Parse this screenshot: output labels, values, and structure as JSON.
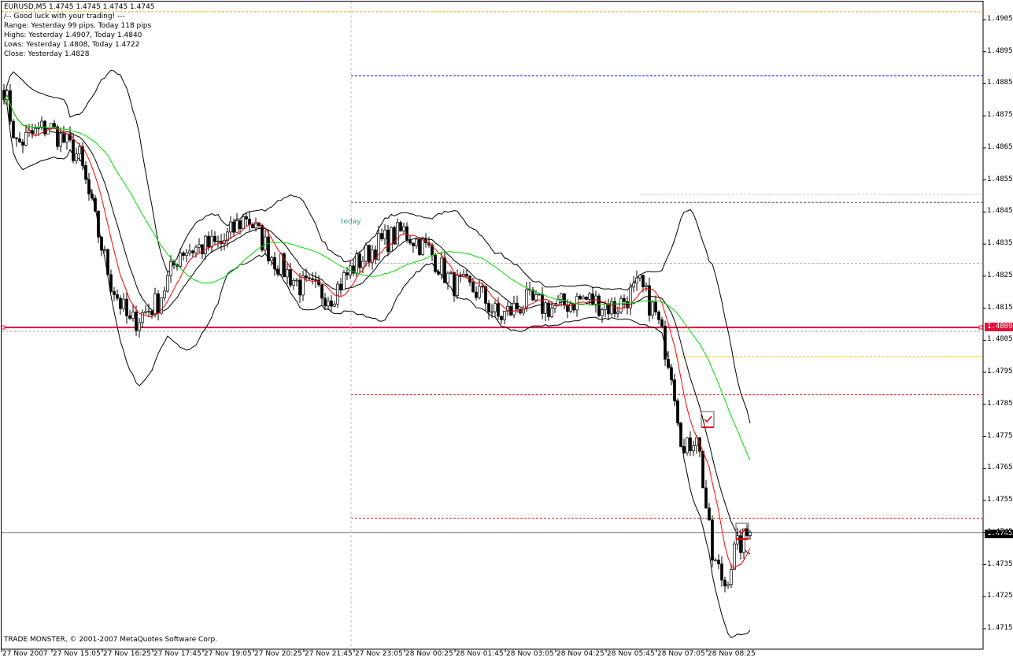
{
  "header": {
    "symbol_line": "EURUSD,M5  1.4745 1.4745 1.4745 1.4745",
    "lines": [
      "/-- Good luck with your trading! ---",
      "Range: Yesterday 99 pips, Today 118 pips",
      "Highs: Yesterday 1.4907, Today 1.4840",
      "Lows:  Yesterday 1.4808, Today 1.4722",
      "Close: Yesterday 1.4828"
    ]
  },
  "copyright": "TRADE MONSTER, © 2001-2007 MetaQuotes Software Corp.",
  "today_label": "today",
  "current_price": "1.4745",
  "support_price": "1.4809",
  "colors": {
    "up": "#ffffff",
    "down": "#000000",
    "fast_ma": "#ff0000",
    "slow_ma": "#00dd00",
    "bands": "#000000",
    "support": "#e0103a"
  },
  "chart_data": {
    "type": "candlestick",
    "symbol": "EURUSD",
    "timeframe": "M5",
    "ylim": [
      1.4712,
      1.491
    ],
    "y_ticks": [
      "1.4905",
      "1.4895",
      "1.4885",
      "1.4875",
      "1.4865",
      "1.4855",
      "1.4845",
      "1.4835",
      "1.4825",
      "1.4815",
      "1.4805",
      "1.4795",
      "1.4785",
      "1.4775",
      "1.4765",
      "1.4755",
      "1.4745",
      "1.4735",
      "1.4725",
      "1.4715"
    ],
    "x_ticks": [
      "27 Nov 2007",
      "27 Nov 15:05",
      "27 Nov 16:25",
      "27 Nov 17:45",
      "27 Nov 19:05",
      "27 Nov 20:25",
      "27 Nov 21:45",
      "27 Nov 23:05",
      "28 Nov 00:25",
      "28 Nov 01:45",
      "28 Nov 03:05",
      "28 Nov 04:25",
      "28 Nov 05:45",
      "28 Nov 07:05",
      "28 Nov 08:25"
    ],
    "bars_per_tick": 16,
    "price_path": [
      [
        0,
        1.4884
      ],
      [
        4,
        1.4866
      ],
      [
        14,
        1.4872
      ],
      [
        24,
        1.4862
      ],
      [
        29,
        1.4842
      ],
      [
        34,
        1.4823
      ],
      [
        40,
        1.481
      ],
      [
        49,
        1.4817
      ],
      [
        56,
        1.4833
      ],
      [
        69,
        1.4835
      ],
      [
        77,
        1.4844
      ],
      [
        86,
        1.483
      ],
      [
        94,
        1.4822
      ],
      [
        104,
        1.4819
      ],
      [
        111,
        1.4828
      ],
      [
        119,
        1.4835
      ],
      [
        127,
        1.4839
      ],
      [
        135,
        1.4833
      ],
      [
        142,
        1.4823
      ],
      [
        151,
        1.482
      ],
      [
        157,
        1.4812
      ],
      [
        166,
        1.4817
      ],
      [
        174,
        1.4815
      ],
      [
        184,
        1.4818
      ],
      [
        194,
        1.4815
      ],
      [
        202,
        1.4822
      ],
      [
        207,
        1.4813
      ],
      [
        212,
        1.4796
      ],
      [
        216,
        1.4769
      ],
      [
        220,
        1.4777
      ],
      [
        225,
        1.4737
      ],
      [
        229,
        1.4729
      ],
      [
        232,
        1.4739
      ],
      [
        236,
        1.4744
      ],
      [
        237,
        1.4745
      ]
    ],
    "levels": [
      {
        "price": 1.49075,
        "color": "#ffa500",
        "style": "dash",
        "from_today": false
      },
      {
        "price": 1.48875,
        "color": "#0000ff",
        "style": "dash",
        "from_today": true
      },
      {
        "price": 1.48505,
        "color": "#cccccc",
        "style": "dash",
        "from_today": false,
        "partial": true
      },
      {
        "price": 1.4848,
        "color": "#555555",
        "style": "dash",
        "from_today": true
      },
      {
        "price": 1.4829,
        "color": "#aaaaaa",
        "style": "dash",
        "from_today": true
      },
      {
        "price": 1.4809,
        "color": "#e0103a",
        "style": "solid",
        "from_today": false
      },
      {
        "price": 1.48078,
        "color": "#aaaaaa",
        "style": "dash",
        "from_today": false
      },
      {
        "price": 1.47998,
        "color": "#ffc800",
        "style": "dash",
        "from_today": false,
        "partial2": true
      },
      {
        "price": 1.4788,
        "color": "#ee2222",
        "style": "dash",
        "from_today": true
      },
      {
        "price": 1.47505,
        "color": "#dddddd",
        "style": "dash",
        "from_today": true
      },
      {
        "price": 1.47495,
        "color": "#ee2222",
        "style": "dash",
        "from_today": true
      },
      {
        "price": 1.4745,
        "color": "#777777",
        "style": "solid",
        "from_today": false
      }
    ],
    "today_bar": 111
  }
}
